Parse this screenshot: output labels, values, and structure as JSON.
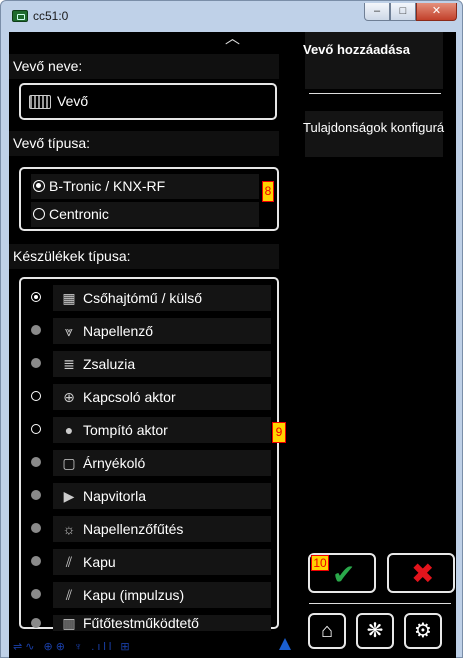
{
  "window": {
    "title": "cc51:0",
    "minimize": "–",
    "maximize": "□",
    "close": "✕"
  },
  "left": {
    "collapse_glyph": "︿",
    "receiver_name_label": "Vevő neve:",
    "receiver_name_value": "Vevő",
    "receiver_type_label": "Vevő típusa:",
    "receiver_types": [
      {
        "label": "B-Tronic / KNX-RF",
        "selected": true
      },
      {
        "label": "Centronic",
        "selected": false
      }
    ],
    "badge_receiver_type": "8",
    "device_type_label": "Készülékek típusa:",
    "device_types": [
      {
        "label": "Csőhajtómű / külső",
        "icon": "tubular-motor-icon",
        "state": "selected"
      },
      {
        "label": "Napellenző",
        "icon": "awning-icon",
        "state": "disabled"
      },
      {
        "label": "Zsaluzia",
        "icon": "venetian-blind-icon",
        "state": "disabled"
      },
      {
        "label": "Kapcsoló aktor",
        "icon": "switch-actuator-icon",
        "state": "enabled"
      },
      {
        "label": "Tompító aktor",
        "icon": "dimmer-bulb-icon",
        "state": "enabled"
      },
      {
        "label": "Árnyékoló",
        "icon": "shade-icon",
        "state": "disabled"
      },
      {
        "label": "Napvitorla",
        "icon": "sun-sail-icon",
        "state": "disabled"
      },
      {
        "label": "Napellenzőfűtés",
        "icon": "awning-heater-icon",
        "state": "disabled"
      },
      {
        "label": "Kapu",
        "icon": "gate-icon",
        "state": "disabled"
      },
      {
        "label": "Kapu (impulzus)",
        "icon": "gate-impulse-icon",
        "state": "disabled"
      },
      {
        "label": "Fűtőtestműködtető",
        "icon": "radiator-actuator-icon",
        "state": "disabled"
      }
    ],
    "badge_device_type": "9"
  },
  "right": {
    "title": "Vevő hozzáadása",
    "properties": "Tulajdonságok konfigurá",
    "badge_confirm": "10",
    "confirm_glyph": "✔",
    "cancel_glyph": "✖",
    "home_glyph": "⌂",
    "fan_glyph": "❋",
    "settings_glyph": "⚙"
  },
  "colors": {
    "confirm": "#2aa84a",
    "cancel": "#e3141c",
    "badge_fill": "#ffd300",
    "badge_border": "#ee0000"
  }
}
